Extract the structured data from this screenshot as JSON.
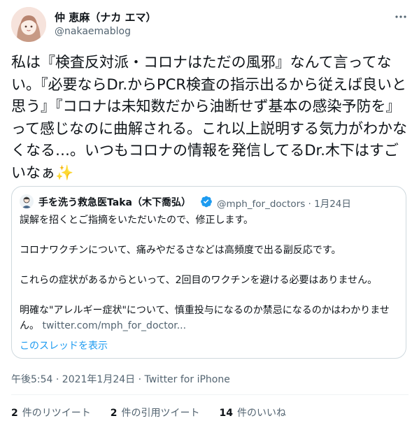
{
  "author": {
    "display_name": "仲 恵麻（ナカ エマ）",
    "handle": "@nakaemablog"
  },
  "tweet": {
    "text": "私は『検査反対派・コロナはただの風邪』なんて言ってない。『必要ならDr.からPCR検査の指示出るから従えば良いと思う』『コロナは未知数だから油断せず基本の感染予防を』って感じなのに曲解される。これ以上説明する気力がわかなくなる…。いつもコロナの情報を発信してるDr.木下はすごいなぁ",
    "emoji": "✨",
    "timestamp": "午後5:54 · 2021年1月24日",
    "source": "Twitter for iPhone"
  },
  "quoted": {
    "display_name": "手を洗う救急医Taka（木下喬弘）",
    "handle_date": "@mph_for_doctors · 1月24日",
    "line1": "誤解を招くとご指摘をいただいたので、修正します。",
    "line2": "コロナワクチンについて、痛みやだるさなどは高頻度で出る副反応です。",
    "line3": "これらの症状があるからといって、2回目のワクチンを避ける必要はありません。",
    "line4": "明確な\"アレルギー症状\"について、慎重投与になるのか禁忌になるのかはわかりません。",
    "link": "twitter.com/mph_for_doctor...",
    "show_thread": "このスレッドを表示"
  },
  "stats": {
    "retweets_count": "2",
    "retweets_label": "件のリツイート",
    "quotes_count": "2",
    "quotes_label": "件の引用ツイート",
    "likes_count": "14",
    "likes_label": "件のいいね"
  },
  "colors": {
    "link_blue": "#1d9bf0",
    "secondary_text": "#536471",
    "border": "#cfd9de"
  }
}
